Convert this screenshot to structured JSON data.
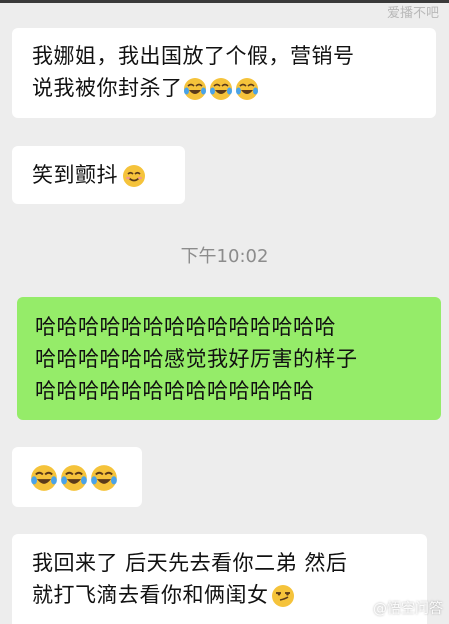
{
  "chat": {
    "messages": [
      {
        "direction": "in",
        "lines": [
          "我娜姐，我出国放了个假，营销号",
          "说我被你封杀了"
        ],
        "emoji_after_last_line": [
          "laughing-crying-emoji",
          "laughing-crying-emoji",
          "laughing-crying-emoji"
        ]
      },
      {
        "direction": "in",
        "lines": [
          "笑到颤抖"
        ],
        "emoji_after_last_line": [
          "smiling-emoji"
        ]
      },
      {
        "direction": "out",
        "lines": [
          "哈哈哈哈哈哈哈哈哈哈哈哈哈哈",
          "哈哈哈哈哈哈感觉我好厉害的样子",
          "哈哈哈哈哈哈哈哈哈哈哈哈哈"
        ]
      },
      {
        "direction": "in",
        "lines": [],
        "emoji_after_last_line": [
          "laughing-crying-emoji",
          "laughing-crying-emoji",
          "laughing-crying-emoji"
        ]
      },
      {
        "direction": "in",
        "lines": [
          "我回来了 后天先去看你二弟 然后",
          "就打飞滴去看你和俩闺女"
        ],
        "emoji_after_last_line": [
          "smirk-emoji"
        ]
      }
    ],
    "timestamp": "下午10:02"
  },
  "colors": {
    "background": "#ededed",
    "incoming_bubble": "#ffffff",
    "outgoing_bubble": "#95ec69",
    "timestamp_text": "#8c8c8c"
  },
  "watermark": {
    "top": "爱播不吧",
    "bottom": "@悟空问答"
  }
}
